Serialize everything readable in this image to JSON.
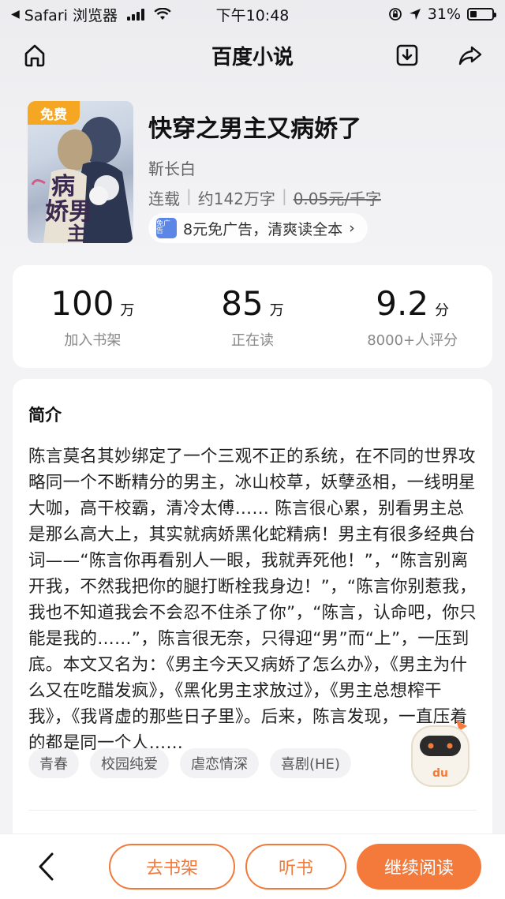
{
  "status_bar": {
    "back_app": "Safari 浏览器",
    "time": "下午10:48",
    "battery": "31%",
    "battery_level": 0.31
  },
  "nav": {
    "title": "百度小说"
  },
  "book": {
    "cover_badge": "免费",
    "title": "快穿之男主又病娇了",
    "author": "靳长白",
    "status": "连载",
    "word_count": "约142万字",
    "price": "0.05元/千字",
    "ad_free_offer": "8元免广告，清爽读全本",
    "ad_icon_text": "免广告",
    "chevron": "›"
  },
  "stats": [
    {
      "value": "100",
      "unit": "万",
      "label": "加入书架"
    },
    {
      "value": "85",
      "unit": "万",
      "label": "正在读"
    },
    {
      "value": "9.2",
      "unit": "分",
      "label": "8000+人评分"
    }
  ],
  "intro": {
    "heading": "简介",
    "text": "陈言莫名其妙绑定了一个三观不正的系统，在不同的世界攻略同一个不断精分的男主，冰山校草，妖孽丞相，一线明星大咖，高干校霸，清冷太傅…… 陈言很心累，别看男主总是那么高大上，其实就病娇黑化蛇精病！男主有很多经典台词——“陈言你再看别人一眼，我就弄死他！”，“陈言别离开我，不然我把你的腿打断栓我身边！”，“陈言你别惹我，我也不知道我会不会忍不住杀了你”，“陈言，认命吧，你只能是我的……”，陈言很无奈，只得迎“男”而“上”，一压到底。本文又名为：《男主今天又病娇了怎么办》，《男主为什么又在吃醋发疯》，《黑化男主求放过》，《男主总想榨干我》，《我肾虚的那些日子里》。后来，陈言发现，一直压着的都是同一个人……",
    "tags": [
      "青春",
      "校园纯爱",
      "虐恋情深",
      "喜剧(HE)"
    ]
  },
  "mascot_label": "du",
  "bottom_bar": {
    "shelf_label": "去书架",
    "listen_label": "听书",
    "continue_label": "继续阅读"
  },
  "colors": {
    "accent": "#f47a3c",
    "badge": "#f5a623"
  }
}
